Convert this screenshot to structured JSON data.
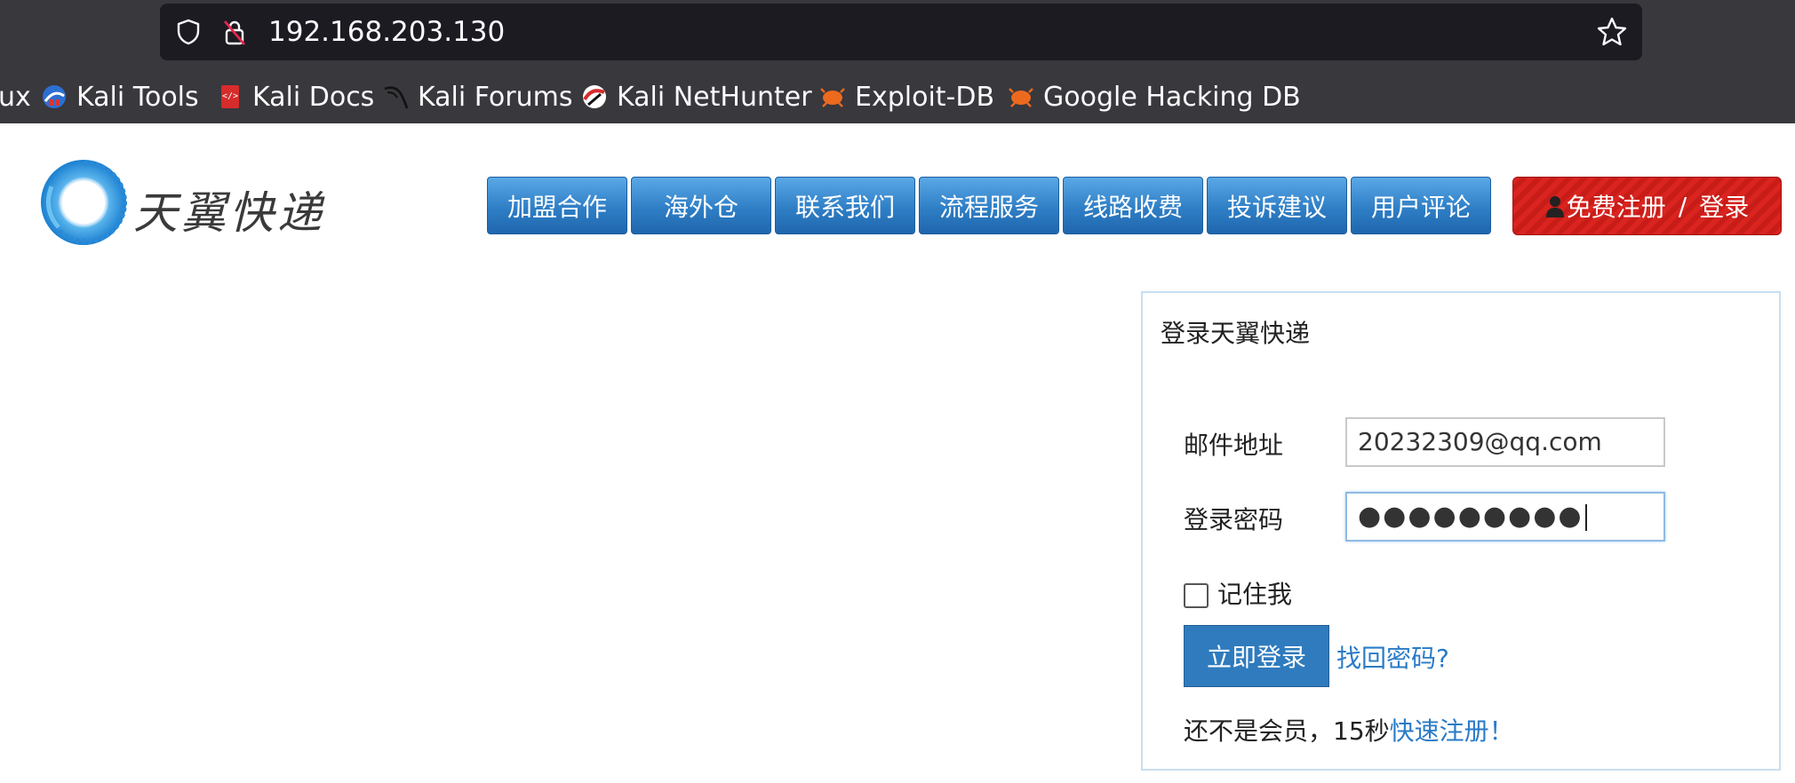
{
  "browser": {
    "url": "192.168.203.130",
    "bookmarks": [
      {
        "label": "ux",
        "icon": "kali-linux-icon"
      },
      {
        "label": "Kali Tools",
        "icon": "kali-tools-icon"
      },
      {
        "label": "Kali Docs",
        "icon": "kali-docs-icon"
      },
      {
        "label": "Kali Forums",
        "icon": "kali-dragon-icon"
      },
      {
        "label": "Kali NetHunter",
        "icon": "kali-nethunter-icon"
      },
      {
        "label": "Exploit-DB",
        "icon": "exploit-db-icon"
      },
      {
        "label": "Google Hacking DB",
        "icon": "ghdb-icon"
      }
    ]
  },
  "header": {
    "logo_text": "天翼快递",
    "nav": [
      "加盟合作",
      "海外仓",
      "联系我们",
      "流程服务",
      "线路收费",
      "投诉建议",
      "用户评论"
    ],
    "register_label": "免费注册",
    "separator": "/",
    "login_label": "登录"
  },
  "login": {
    "title": "登录天翼快递",
    "email_label": "邮件地址",
    "email_value": "20232309@qq.com",
    "password_label": "登录密码",
    "password_masked": "●●●●●●●●●",
    "remember_label": "记住我",
    "submit_label": "立即登录",
    "forgot_label": "找回密码?",
    "signup_prefix": "还不是会员，15秒",
    "signup_link": "快速注册！"
  },
  "colors": {
    "nav_blue": "#2f7fc6",
    "register_red": "#d9241f",
    "link_blue": "#2a7bc6",
    "chrome_bg": "#38383d"
  }
}
